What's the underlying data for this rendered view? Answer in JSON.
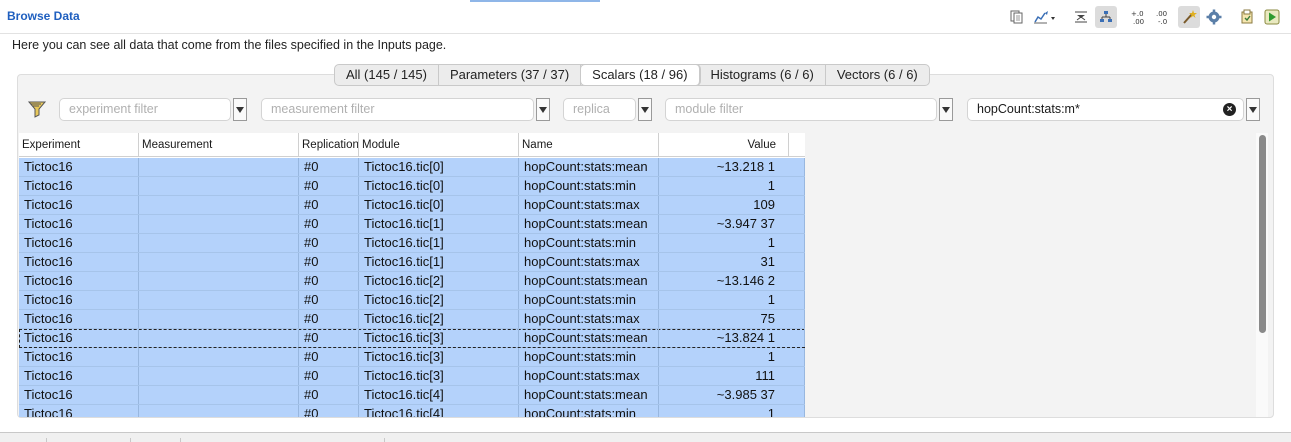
{
  "page": {
    "title": "Browse Data",
    "intro": "Here you can see all data that come from the files specified in the Inputs page."
  },
  "toolbar": {
    "icons": [
      "copy-icon",
      "export-icon",
      "flat-view-icon",
      "tree-view-icon",
      "increase-decimals-icon",
      "decrease-decimals-icon",
      "wand-icon",
      "settings-icon",
      "save-icon",
      "run-icon"
    ]
  },
  "tabs": [
    {
      "label": "All (145 / 145)"
    },
    {
      "label": "Parameters (37 / 37)"
    },
    {
      "label": "Scalars (18 / 96)",
      "selected": true
    },
    {
      "label": "Histograms (6 / 6)"
    },
    {
      "label": "Vectors (6 / 6)"
    }
  ],
  "filters": {
    "experiment": {
      "placeholder": "experiment filter",
      "value": ""
    },
    "measurement": {
      "placeholder": "measurement filter",
      "value": ""
    },
    "replica": {
      "placeholder": "replica",
      "value": ""
    },
    "module": {
      "placeholder": "module filter",
      "value": ""
    },
    "name": {
      "placeholder": "",
      "value": "hopCount:stats:m*"
    }
  },
  "table": {
    "columns": [
      "Experiment",
      "Measurement",
      "Replication",
      "Module",
      "Name",
      "Value"
    ],
    "rows": [
      {
        "experiment": "Tictoc16",
        "measurement": "",
        "replication": "#0",
        "module": "Tictoc16.tic[0]",
        "name": "hopCount:stats:mean",
        "value": "~13.218 1"
      },
      {
        "experiment": "Tictoc16",
        "measurement": "",
        "replication": "#0",
        "module": "Tictoc16.tic[0]",
        "name": "hopCount:stats:min",
        "value": "1"
      },
      {
        "experiment": "Tictoc16",
        "measurement": "",
        "replication": "#0",
        "module": "Tictoc16.tic[0]",
        "name": "hopCount:stats:max",
        "value": "109"
      },
      {
        "experiment": "Tictoc16",
        "measurement": "",
        "replication": "#0",
        "module": "Tictoc16.tic[1]",
        "name": "hopCount:stats:mean",
        "value": "~3.947 37"
      },
      {
        "experiment": "Tictoc16",
        "measurement": "",
        "replication": "#0",
        "module": "Tictoc16.tic[1]",
        "name": "hopCount:stats:min",
        "value": "1"
      },
      {
        "experiment": "Tictoc16",
        "measurement": "",
        "replication": "#0",
        "module": "Tictoc16.tic[1]",
        "name": "hopCount:stats:max",
        "value": "31"
      },
      {
        "experiment": "Tictoc16",
        "measurement": "",
        "replication": "#0",
        "module": "Tictoc16.tic[2]",
        "name": "hopCount:stats:mean",
        "value": "~13.146 2"
      },
      {
        "experiment": "Tictoc16",
        "measurement": "",
        "replication": "#0",
        "module": "Tictoc16.tic[2]",
        "name": "hopCount:stats:min",
        "value": "1"
      },
      {
        "experiment": "Tictoc16",
        "measurement": "",
        "replication": "#0",
        "module": "Tictoc16.tic[2]",
        "name": "hopCount:stats:max",
        "value": "75"
      },
      {
        "experiment": "Tictoc16",
        "measurement": "",
        "replication": "#0",
        "module": "Tictoc16.tic[3]",
        "name": "hopCount:stats:mean",
        "value": "~13.824 1",
        "focused": true
      },
      {
        "experiment": "Tictoc16",
        "measurement": "",
        "replication": "#0",
        "module": "Tictoc16.tic[3]",
        "name": "hopCount:stats:min",
        "value": "1"
      },
      {
        "experiment": "Tictoc16",
        "measurement": "",
        "replication": "#0",
        "module": "Tictoc16.tic[3]",
        "name": "hopCount:stats:max",
        "value": "111"
      },
      {
        "experiment": "Tictoc16",
        "measurement": "",
        "replication": "#0",
        "module": "Tictoc16.tic[4]",
        "name": "hopCount:stats:mean",
        "value": "~3.985 37"
      },
      {
        "experiment": "Tictoc16",
        "measurement": "",
        "replication": "#0",
        "module": "Tictoc16.tic[4]",
        "name": "hopCount:stats:min",
        "value": "1"
      }
    ]
  },
  "colors": {
    "title": "#1f5fbf",
    "selection": "#b4d2fb"
  }
}
